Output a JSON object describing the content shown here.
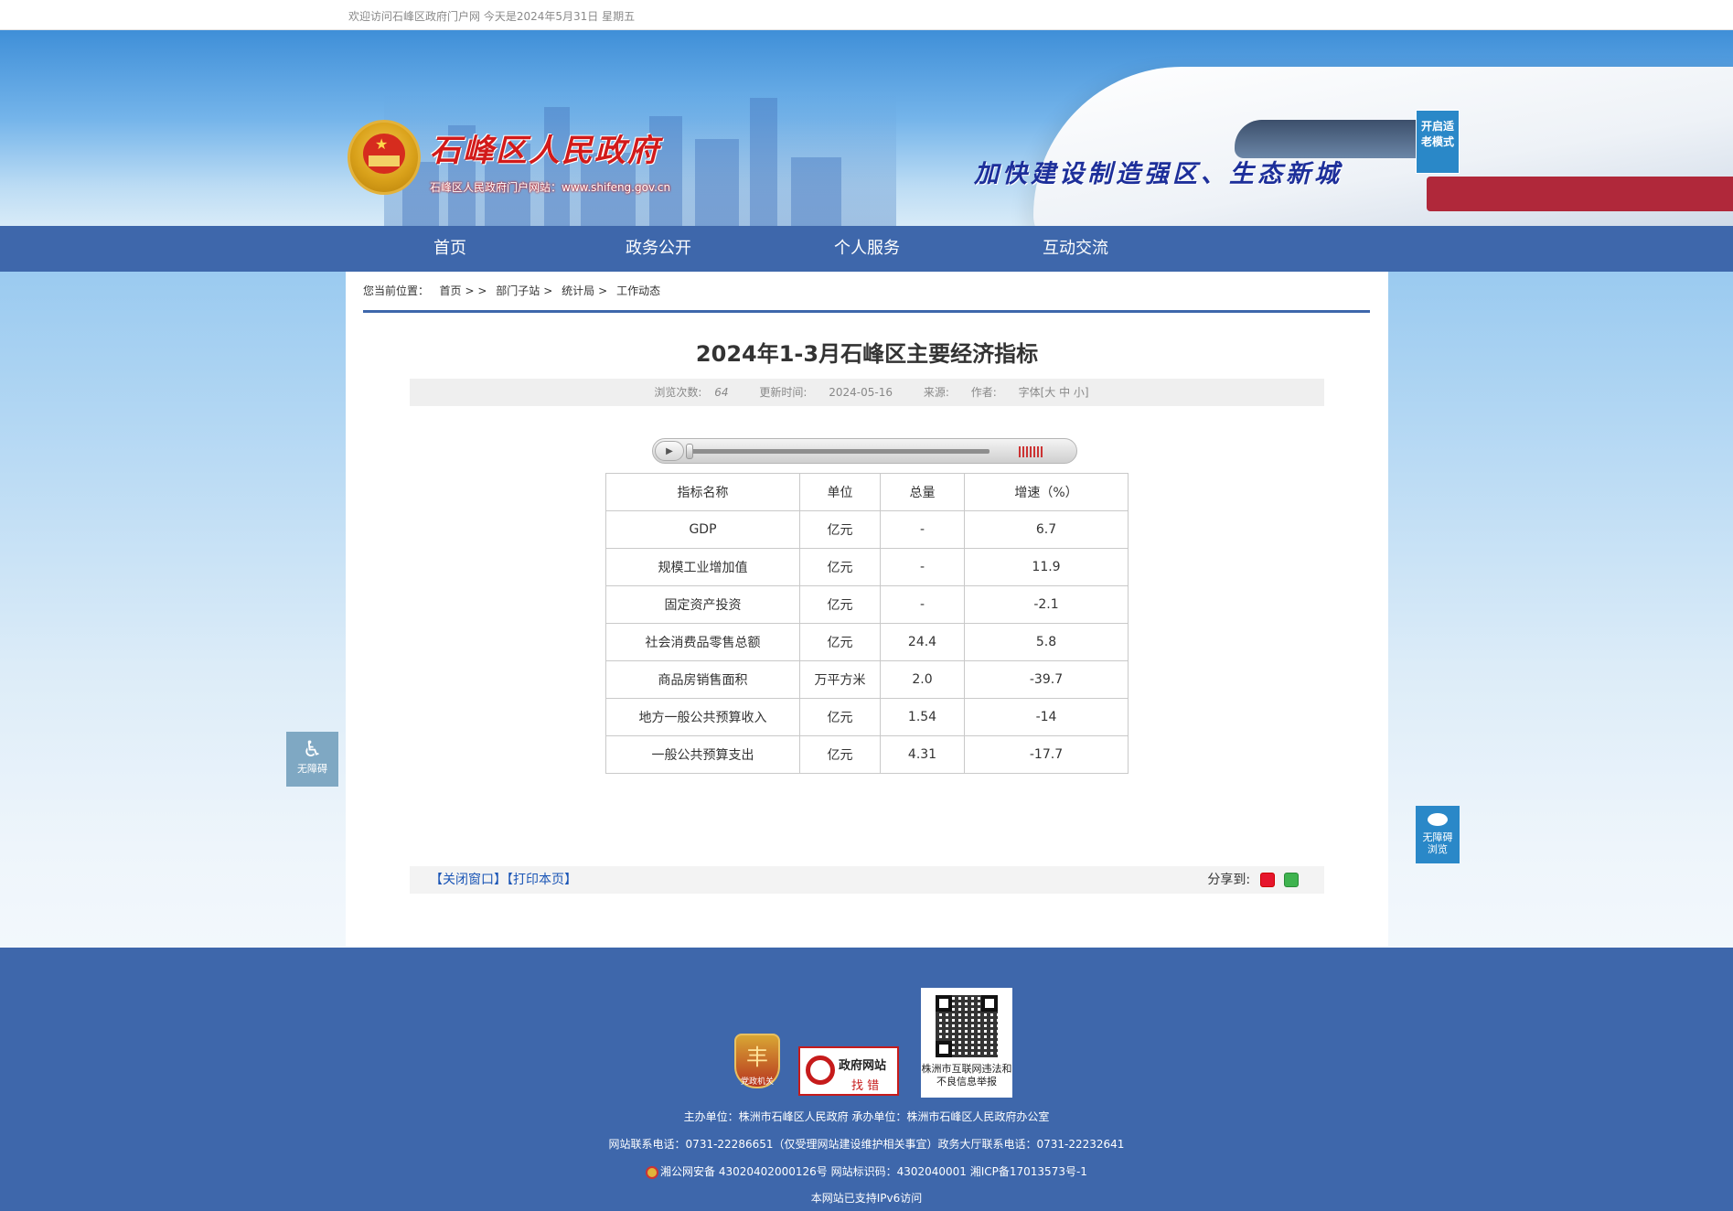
{
  "topbar": {
    "welcome": "欢迎访问石峰区政府门户网 今天是2024年5月31日 星期五"
  },
  "banner": {
    "site_title": "石峰区人民政府",
    "site_subtitle": "石峰区人民政府门户网站：www.shifeng.gov.cn",
    "slogan": "加快建设制造强区、生态新城",
    "elder_mode_label": "开启适老模式"
  },
  "nav": {
    "items": [
      {
        "label": "首页"
      },
      {
        "label": "政务公开"
      },
      {
        "label": "个人服务"
      },
      {
        "label": "互动交流"
      }
    ]
  },
  "breadcrumb": {
    "prefix": "您当前位置：",
    "items": [
      "首页",
      "部门子站",
      "统计局",
      "工作动态"
    ],
    "sep1": "> >",
    "sep2": ">",
    "sep3": ">"
  },
  "article": {
    "title": "2024年1-3月石峰区主要经济指标",
    "meta": {
      "views_label": "浏览次数:",
      "views_value": "64",
      "updated_label": "更新时间:",
      "updated_value": "2024-05-16",
      "source_label": "来源:",
      "author_label": "作者:",
      "font_label": "字体[大 中 小]"
    },
    "player": {
      "play_icon": "play-icon",
      "progress": 0.0
    }
  },
  "table": {
    "headers": [
      "指标名称",
      "单位",
      "总量",
      "增速（%）"
    ],
    "rows": [
      [
        "GDP",
        "亿元",
        "-",
        "6.7"
      ],
      [
        "规模工业增加值",
        "亿元",
        "-",
        "11.9"
      ],
      [
        "固定资产投资",
        "亿元",
        "-",
        "-2.1"
      ],
      [
        "社会消费品零售总额",
        "亿元",
        "24.4",
        "5.8"
      ],
      [
        "商品房销售面积",
        "万平方米",
        "2.0",
        "-39.7"
      ],
      [
        "地方一般公共预算收入",
        "亿元",
        "1.54",
        "-14"
      ],
      [
        "一般公共预算支出",
        "亿元",
        "4.31",
        "-17.7"
      ]
    ]
  },
  "actions": {
    "close_label": "【关闭窗口】",
    "print_label": "【打印本页】",
    "share_label": "分享到:"
  },
  "floaters": {
    "accessibility_label": "无障碍",
    "barrier_free_label_1": "无障碍",
    "barrier_free_label_2": "浏览"
  },
  "footer": {
    "party_badge_char": "丰",
    "party_badge_text": "党政机关",
    "gov_badge_t1": "政府网站",
    "gov_badge_t2": "找 错",
    "qr_text": "株洲市互联网违法和不良信息举报",
    "line1": "主办单位：株洲市石峰区人民政府 承办单位：株洲市石峰区人民政府办公室",
    "line2": "网站联系电话：0731-22286651（仅受理网站建设维护相关事宜）政务大厅联系电话：0731-22232641",
    "line3": "湘公网安备 43020402000126号 网站标识码：4302040001 湘ICP备17013573号-1",
    "line4": "本网站已支持IPv6访问"
  },
  "colors": {
    "nav_bg": "#3e67ab",
    "footer_bg": "#3e67ab",
    "link_blue": "#1a55b6",
    "title_red": "#d21a1a",
    "slogan_blue": "#1d2f9a"
  }
}
